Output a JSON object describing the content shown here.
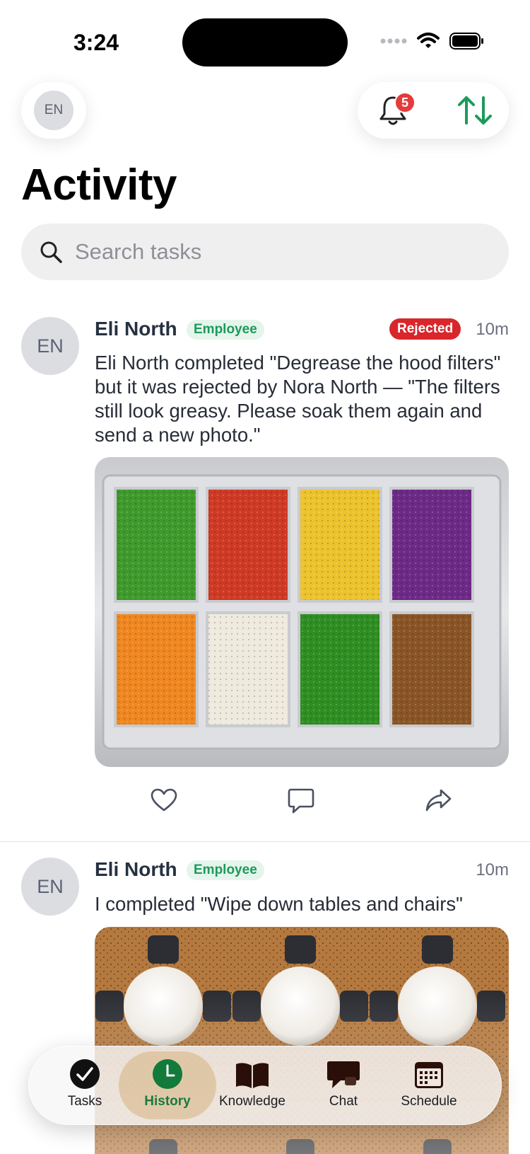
{
  "status_bar": {
    "time": "3:24"
  },
  "header": {
    "avatar_initials": "EN",
    "notification_count": "5",
    "title": "Activity"
  },
  "search": {
    "placeholder": "Search tasks"
  },
  "feed": [
    {
      "initials": "EN",
      "name": "Eli North",
      "role": "Employee",
      "status": "Rejected",
      "time": "10m",
      "text": "Eli North completed \"Degrease the hood filters\" but it was rejected by Nora North — \"The filters still look greasy. Please soak them again and send a new photo.\"",
      "photo_colors": [
        "#3f9a2c",
        "#cf3a25",
        "#ecc22d",
        "#6d2a86",
        "#ef8720",
        "#efeade",
        "#2f8e23",
        "#8a5526"
      ]
    },
    {
      "initials": "EN",
      "name": "Eli North",
      "role": "Employee",
      "time": "10m",
      "text": "I completed \"Wipe down tables and chairs\""
    }
  ],
  "tabs": [
    {
      "label": "Tasks",
      "icon": "checkmark-circle-icon"
    },
    {
      "label": "History",
      "icon": "clock-icon",
      "active": true
    },
    {
      "label": "Knowledge",
      "icon": "book-icon"
    },
    {
      "label": "Chat",
      "icon": "chat-bubble-icon"
    },
    {
      "label": "Schedule",
      "icon": "calendar-icon"
    }
  ],
  "colors": {
    "accent_green": "#1d9a5b",
    "rejected_red": "#d9262b",
    "badge_red": "#e43b3b"
  }
}
